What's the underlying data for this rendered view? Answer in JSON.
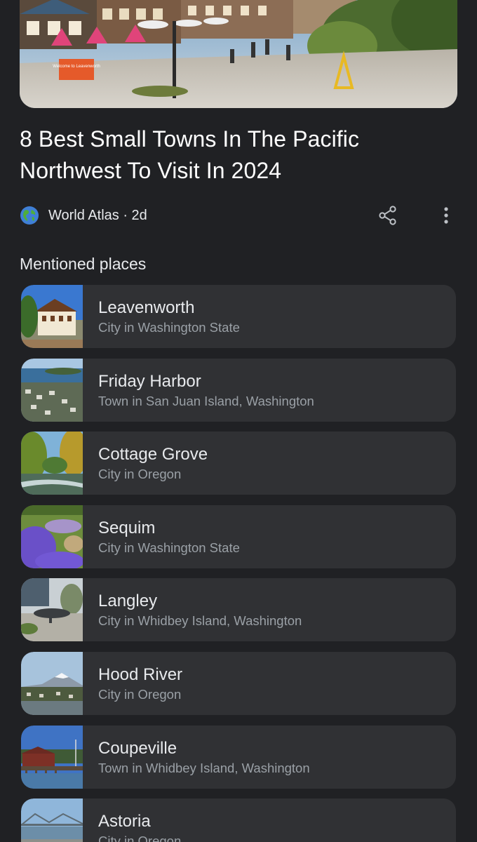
{
  "article": {
    "title": "8 Best Small Towns In The Pacific Northwest To Visit In 2024",
    "source": "World Atlas",
    "age": "2d",
    "source_line": "World Atlas · 2d",
    "hero_sign": "Welcome to Leavenworth"
  },
  "icons": {
    "source": "globe-icon",
    "share": "share-icon",
    "more": "more-vert-icon"
  },
  "section": {
    "title": "Mentioned places"
  },
  "places": [
    {
      "name": "Leavenworth",
      "description": "City in Washington State",
      "thumb": "leavenworth"
    },
    {
      "name": "Friday Harbor",
      "description": "Town in San Juan Island, Washington",
      "thumb": "harbor"
    },
    {
      "name": "Cottage Grove",
      "description": "City in Oregon",
      "thumb": "river"
    },
    {
      "name": "Sequim",
      "description": "City in Washington State",
      "thumb": "lavender"
    },
    {
      "name": "Langley",
      "description": "City in Whidbey Island, Washington",
      "thumb": "whale"
    },
    {
      "name": "Hood River",
      "description": "City in Oregon",
      "thumb": "mountain"
    },
    {
      "name": "Coupeville",
      "description": "Town in Whidbey Island, Washington",
      "thumb": "pier"
    },
    {
      "name": "Astoria",
      "description": "City in Oregon",
      "thumb": "bridge"
    }
  ],
  "colors": {
    "background": "#202124",
    "card": "#303134",
    "primary_text": "#e8eaed",
    "secondary_text": "#9aa0a6"
  }
}
